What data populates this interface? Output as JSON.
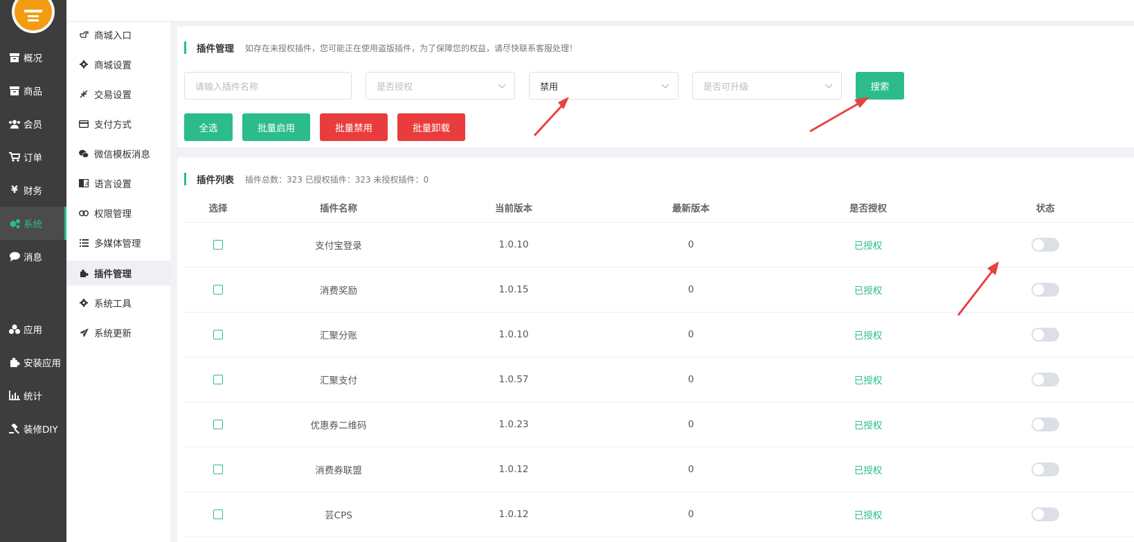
{
  "nav": {
    "items": [
      {
        "label": "概况",
        "icon": "archive-icon"
      },
      {
        "label": "商品",
        "icon": "box-icon"
      },
      {
        "label": "会员",
        "icon": "users-icon"
      },
      {
        "label": "订单",
        "icon": "cart-icon"
      },
      {
        "label": "财务",
        "icon": "yen-icon"
      },
      {
        "label": "系统",
        "icon": "gears-icon",
        "active": true
      },
      {
        "label": "消息",
        "icon": "chat-icon"
      },
      {
        "label": "应用",
        "icon": "cubes-icon"
      },
      {
        "label": "安装应用",
        "icon": "puzzle-icon"
      },
      {
        "label": "统计",
        "icon": "bar-chart-icon"
      },
      {
        "label": "装修DIY",
        "icon": "gavel-icon"
      }
    ]
  },
  "submenu": {
    "items": [
      {
        "label": "商城入口",
        "icon": "hand-icon"
      },
      {
        "label": "商城设置",
        "icon": "gear-icon"
      },
      {
        "label": "交易设置",
        "icon": "compress-icon"
      },
      {
        "label": "支付方式",
        "icon": "credit-card-icon"
      },
      {
        "label": "微信模板消息",
        "icon": "wechat-icon"
      },
      {
        "label": "语言设置",
        "icon": "language-icon"
      },
      {
        "label": "权限管理",
        "icon": "link-icon"
      },
      {
        "label": "多媒体管理",
        "icon": "list-icon"
      },
      {
        "label": "插件管理",
        "icon": "puzzle-icon",
        "active": true
      },
      {
        "label": "系统工具",
        "icon": "gear-icon"
      },
      {
        "label": "系统更新",
        "icon": "paper-plane-icon"
      }
    ]
  },
  "filter": {
    "title": "插件管理",
    "notice": "如存在未授权插件，您可能正在使用盗版插件，为了保障您的权益，请尽快联系客服处理！",
    "name_placeholder": "请输入插件名称",
    "authorized_placeholder": "是否授权",
    "status_value": "禁用",
    "upgradable_placeholder": "是否可升级",
    "search_label": "搜索",
    "select_all_label": "全选",
    "batch_enable_label": "批量启用",
    "batch_disable_label": "批量禁用",
    "batch_uninstall_label": "批量卸载"
  },
  "list": {
    "title": "插件列表",
    "summary": "插件总数：323 已授权插件：323 未授权插件：0",
    "columns": [
      "选择",
      "插件名称",
      "当前版本",
      "最新版本",
      "是否授权",
      "状态"
    ],
    "rows": [
      {
        "name": "支付宝登录",
        "current": "1.0.10",
        "latest": "0",
        "auth": "已授权",
        "enabled": false
      },
      {
        "name": "消费奖励",
        "current": "1.0.15",
        "latest": "0",
        "auth": "已授权",
        "enabled": false
      },
      {
        "name": "汇聚分账",
        "current": "1.0.10",
        "latest": "0",
        "auth": "已授权",
        "enabled": false
      },
      {
        "name": "汇聚支付",
        "current": "1.0.57",
        "latest": "0",
        "auth": "已授权",
        "enabled": false
      },
      {
        "name": "优惠券二维码",
        "current": "1.0.23",
        "latest": "0",
        "auth": "已授权",
        "enabled": false
      },
      {
        "name": "消费券联盟",
        "current": "1.0.12",
        "latest": "0",
        "auth": "已授权",
        "enabled": false
      },
      {
        "name": "芸CPS",
        "current": "1.0.12",
        "latest": "0",
        "auth": "已授权",
        "enabled": false
      }
    ]
  },
  "colors": {
    "accent": "#2bbc8a",
    "danger": "#e93c3c",
    "sidebar": "#3d3d3d",
    "annotation_arrow": "#e94040"
  }
}
